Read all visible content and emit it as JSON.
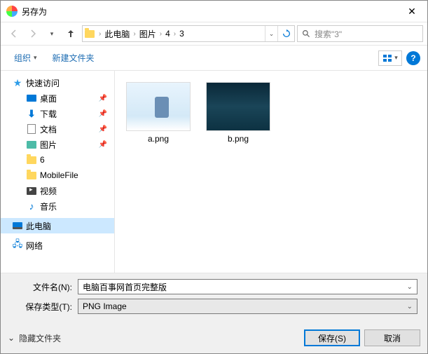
{
  "title": "另存为",
  "breadcrumb": {
    "p0": "此电脑",
    "p1": "图片",
    "p2": "4",
    "p3": "3"
  },
  "search": {
    "placeholder": "搜索\"3\""
  },
  "toolbar": {
    "organize": "组织",
    "newfolder": "新建文件夹"
  },
  "sidebar": {
    "quick": "快速访问",
    "desktop": "桌面",
    "downloads": "下载",
    "documents": "文档",
    "pictures": "图片",
    "six": "6",
    "mobilefile": "MobileFile",
    "videos": "视频",
    "music": "音乐",
    "thispc": "此电脑",
    "network": "网络"
  },
  "files": {
    "a": "a.png",
    "b": "b.png"
  },
  "fields": {
    "name_label": "文件名(N):",
    "name_value": "电脑百事网首页完整版",
    "type_label": "保存类型(T):",
    "type_value": "PNG Image"
  },
  "footer": {
    "hide": "隐藏文件夹",
    "save": "保存(S)",
    "cancel": "取消"
  }
}
